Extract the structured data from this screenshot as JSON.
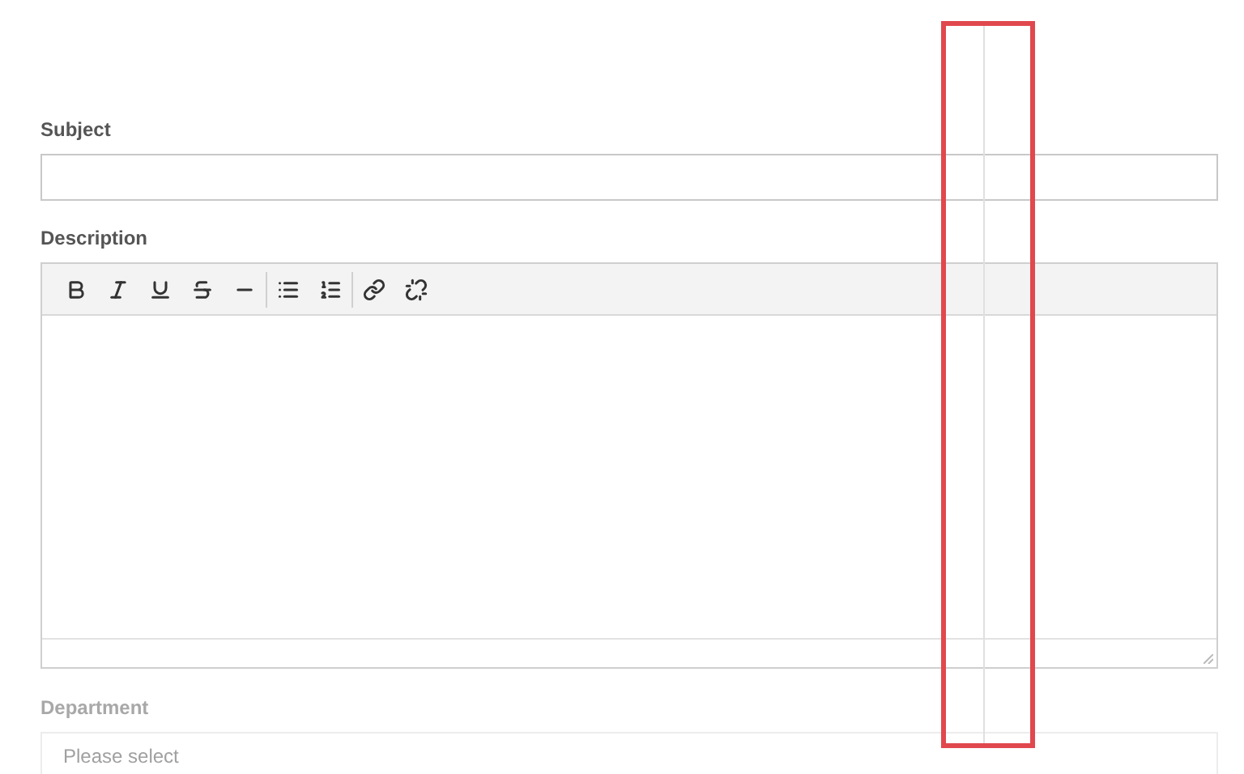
{
  "fields": [
    {
      "kind": "text",
      "label": "Subject",
      "disabled": false
    },
    {
      "kind": "editor",
      "label": "Description",
      "disabled": false,
      "toolbar": [
        {
          "tools": [
            {
              "kind": "bold"
            },
            {
              "kind": "italic"
            },
            {
              "kind": "underline"
            },
            {
              "kind": "strikethrough"
            },
            {
              "kind": "rule"
            }
          ]
        },
        {
          "tools": [
            {
              "kind": "bullets"
            },
            {
              "kind": "numbers"
            }
          ]
        },
        {
          "tools": [
            {
              "kind": "link"
            },
            {
              "kind": "unlink"
            }
          ]
        }
      ]
    },
    {
      "kind": "select",
      "label": "Department",
      "disabled": true,
      "placeholder": "Please select"
    }
  ]
}
